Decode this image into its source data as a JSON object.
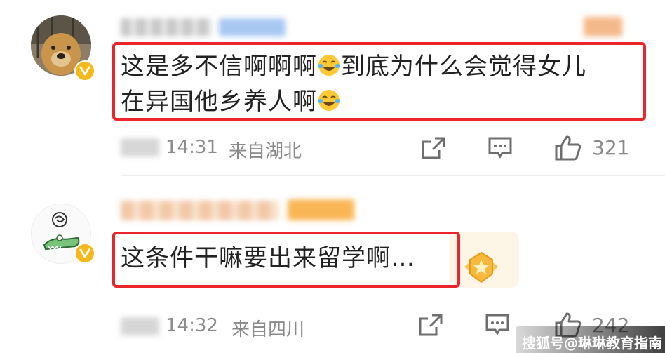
{
  "comments": [
    {
      "text_line1": "这是多不信啊啊啊",
      "emoji": "laugh-cry-emoji",
      "text_line1b": "到底为什么会觉得女儿",
      "text_line2": "在异国他乡养人啊",
      "time": "14:31",
      "location": "来自湖北",
      "like_count": "321",
      "verified_badge_color": "#f6b91b"
    },
    {
      "text": "这条件干嘛要出来留学啊…",
      "time": "14:32",
      "location": "来自四川",
      "like_count": "242",
      "verified_badge_color": "#f6b91b"
    }
  ],
  "watermark": "搜狐号@琳琳教育指南",
  "colors": {
    "highlight": "#e8262b",
    "meta_text": "#8a8a8a",
    "body_text": "#222222"
  }
}
